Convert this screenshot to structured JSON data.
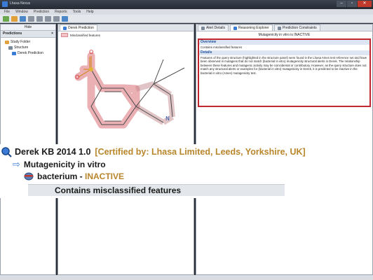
{
  "window": {
    "title": "Lhasa Nexus"
  },
  "menu": [
    "File",
    "Window",
    "Prediction",
    "Reports",
    "Tools",
    "Help"
  ],
  "left": {
    "hide_label": "Hide",
    "predictions_title": "Predictions",
    "tree": [
      "Study Folder",
      "Structure",
      "Derek Prediction"
    ]
  },
  "center": {
    "tab": "Derek Prediction",
    "legend": "Misclassified features"
  },
  "right": {
    "tabs": [
      "Alert Details",
      "Reasoning Explorer",
      "Prediction Constraints"
    ],
    "header": "Mutagenicity in vitro is INACTIVE",
    "overview_label": "Overview",
    "overview_text": "Contains misclassified features",
    "details_label": "Details",
    "details_text": "Features of the query structure (highlighted in the structure panel) were found in the Lhasa Ames test reference set and have been observed in mutagens that do not match (bacterial in vitro) mutagenicity structural alerts in Derek. The relationship between these features and mutagenic activity may be coincidental or contributory. However, as the query structure does not match any structural alerts or examples for (bacterial in vitro) mutagenicity in Derek, it is predicted to be inactive in the bacterial in vitro (Ames) mutagenicity test."
  },
  "zoom": {
    "kb": "Derek KB 2014 1.0",
    "cert": "[Certified by: Lhasa Limited, Leeds, Yorkshire, UK]",
    "endpoint": "Mutagenicity in vitro",
    "species": "bacterium - ",
    "result": "INACTIVE",
    "reason": "Contains misclassified features"
  },
  "colors": {
    "highlight": "#e8a3a8",
    "inactive": "#b8862b",
    "cert": "#b8862b",
    "border_red": "#c0262b",
    "accent": "#3a7bd5"
  }
}
